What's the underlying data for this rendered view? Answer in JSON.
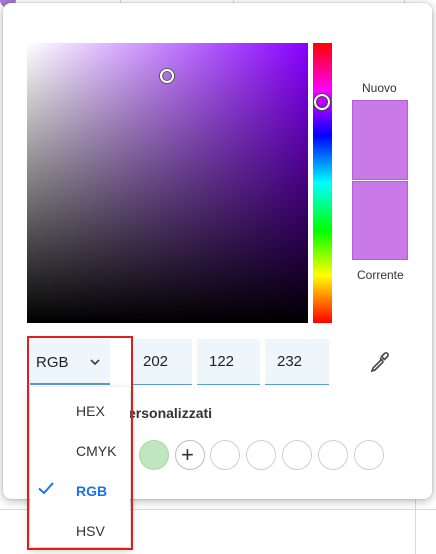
{
  "picker": {
    "new_label": "Nuovo",
    "current_label": "Corrente",
    "new_color": "#ca7ae8",
    "current_color": "#ca7ae8",
    "hue_color": "#8800ff"
  },
  "inputs": {
    "mode_value": "RGB",
    "r": "202",
    "g": "122",
    "b": "232"
  },
  "custom": {
    "label": "ersonalizzati",
    "add_symbol": "+",
    "slot_colors": [
      "#c0e6c0"
    ]
  },
  "dropdown": {
    "options": [
      "HEX",
      "CMYK",
      "RGB",
      "HSV"
    ],
    "selected": "RGB"
  },
  "icons": {
    "eyedropper": "eyedropper-icon",
    "chevron": "chevron-down-icon",
    "check": "check-icon"
  }
}
